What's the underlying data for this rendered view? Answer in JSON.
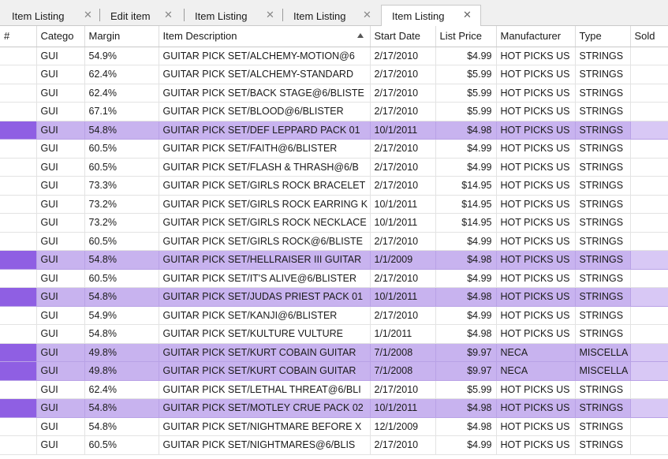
{
  "tabs": [
    {
      "label": "Item Listing",
      "active": false
    },
    {
      "label": "Edit item",
      "active": false
    },
    {
      "label": "Item Listing",
      "active": false
    },
    {
      "label": "Item Listing",
      "active": false
    },
    {
      "label": "Item Listing",
      "active": true
    }
  ],
  "close_glyph": "✕",
  "columns": [
    "#",
    "Catego",
    "Margin",
    "Item Description",
    "Start Date",
    "List Price",
    "Manufacturer",
    "Type",
    "Sold"
  ],
  "sorted_column": "Item Description",
  "rows": [
    {
      "cat": "GUI",
      "margin": "54.9%",
      "desc": "GUITAR PICK SET/ALCHEMY-MOTION@6",
      "date": "2/17/2010",
      "price": "$4.99",
      "mfr": "HOT PICKS US",
      "type": "STRINGS",
      "sold": "",
      "selected": false
    },
    {
      "cat": "GUI",
      "margin": "62.4%",
      "desc": "GUITAR PICK SET/ALCHEMY-STANDARD",
      "date": "2/17/2010",
      "price": "$5.99",
      "mfr": "HOT PICKS US",
      "type": "STRINGS",
      "sold": "",
      "selected": false
    },
    {
      "cat": "GUI",
      "margin": "62.4%",
      "desc": "GUITAR PICK SET/BACK STAGE@6/BLISTE",
      "date": "2/17/2010",
      "price": "$5.99",
      "mfr": "HOT PICKS US",
      "type": "STRINGS",
      "sold": "",
      "selected": false
    },
    {
      "cat": "GUI",
      "margin": "67.1%",
      "desc": "GUITAR PICK SET/BLOOD@6/BLISTER",
      "date": "2/17/2010",
      "price": "$5.99",
      "mfr": "HOT PICKS US",
      "type": "STRINGS",
      "sold": "",
      "selected": false
    },
    {
      "cat": "GUI",
      "margin": "54.8%",
      "desc": "GUITAR PICK SET/DEF LEPPARD PACK 01",
      "date": "10/1/2011",
      "price": "$4.98",
      "mfr": "HOT PICKS US",
      "type": "STRINGS",
      "sold": "",
      "selected": true
    },
    {
      "cat": "GUI",
      "margin": "60.5%",
      "desc": "GUITAR PICK SET/FAITH@6/BLISTER",
      "date": "2/17/2010",
      "price": "$4.99",
      "mfr": "HOT PICKS US",
      "type": "STRINGS",
      "sold": "",
      "selected": false
    },
    {
      "cat": "GUI",
      "margin": "60.5%",
      "desc": "GUITAR PICK SET/FLASH & THRASH@6/B",
      "date": "2/17/2010",
      "price": "$4.99",
      "mfr": "HOT PICKS US",
      "type": "STRINGS",
      "sold": "",
      "selected": false
    },
    {
      "cat": "GUI",
      "margin": "73.3%",
      "desc": "GUITAR PICK SET/GIRLS ROCK BRACELET",
      "date": "2/17/2010",
      "price": "$14.95",
      "mfr": "HOT PICKS US",
      "type": "STRINGS",
      "sold": "",
      "selected": false
    },
    {
      "cat": "GUI",
      "margin": "73.2%",
      "desc": "GUITAR PICK SET/GIRLS ROCK EARRING K",
      "date": "10/1/2011",
      "price": "$14.95",
      "mfr": "HOT PICKS US",
      "type": "STRINGS",
      "sold": "",
      "selected": false
    },
    {
      "cat": "GUI",
      "margin": "73.2%",
      "desc": "GUITAR PICK SET/GIRLS ROCK NECKLACE",
      "date": "10/1/2011",
      "price": "$14.95",
      "mfr": "HOT PICKS US",
      "type": "STRINGS",
      "sold": "",
      "selected": false
    },
    {
      "cat": "GUI",
      "margin": "60.5%",
      "desc": "GUITAR PICK SET/GIRLS ROCK@6/BLISTE",
      "date": "2/17/2010",
      "price": "$4.99",
      "mfr": "HOT PICKS US",
      "type": "STRINGS",
      "sold": "",
      "selected": false
    },
    {
      "cat": "GUI",
      "margin": "54.8%",
      "desc": "GUITAR PICK SET/HELLRAISER III GUITAR",
      "date": "1/1/2009",
      "price": "$4.98",
      "mfr": "HOT PICKS US",
      "type": "STRINGS",
      "sold": "",
      "selected": true
    },
    {
      "cat": "GUI",
      "margin": "60.5%",
      "desc": "GUITAR PICK SET/IT'S ALIVE@6/BLISTER",
      "date": "2/17/2010",
      "price": "$4.99",
      "mfr": "HOT PICKS US",
      "type": "STRINGS",
      "sold": "",
      "selected": false
    },
    {
      "cat": "GUI",
      "margin": "54.8%",
      "desc": "GUITAR PICK SET/JUDAS PRIEST PACK 01",
      "date": "10/1/2011",
      "price": "$4.98",
      "mfr": "HOT PICKS US",
      "type": "STRINGS",
      "sold": "",
      "selected": true
    },
    {
      "cat": "GUI",
      "margin": "54.9%",
      "desc": "GUITAR PICK SET/KANJI@6/BLISTER",
      "date": "2/17/2010",
      "price": "$4.99",
      "mfr": "HOT PICKS US",
      "type": "STRINGS",
      "sold": "",
      "selected": false
    },
    {
      "cat": "GUI",
      "margin": "54.8%",
      "desc": "GUITAR PICK SET/KULTURE VULTURE",
      "date": "1/1/2011",
      "price": "$4.98",
      "mfr": "HOT PICKS US",
      "type": "STRINGS",
      "sold": "",
      "selected": false
    },
    {
      "cat": "GUI",
      "margin": "49.8%",
      "desc": "GUITAR PICK SET/KURT COBAIN GUITAR",
      "date": "7/1/2008",
      "price": "$9.97",
      "mfr": "NECA",
      "type": "MISCELLA",
      "sold": "",
      "selected": true
    },
    {
      "cat": "GUI",
      "margin": "49.8%",
      "desc": "GUITAR PICK SET/KURT COBAIN GUITAR",
      "date": "7/1/2008",
      "price": "$9.97",
      "mfr": "NECA",
      "type": "MISCELLA",
      "sold": "",
      "selected": true
    },
    {
      "cat": "GUI",
      "margin": "62.4%",
      "desc": "GUITAR PICK SET/LETHAL THREAT@6/BLI",
      "date": "2/17/2010",
      "price": "$5.99",
      "mfr": "HOT PICKS US",
      "type": "STRINGS",
      "sold": "",
      "selected": false
    },
    {
      "cat": "GUI",
      "margin": "54.8%",
      "desc": "GUITAR PICK SET/MOTLEY CRUE PACK 02",
      "date": "10/1/2011",
      "price": "$4.98",
      "mfr": "HOT PICKS US",
      "type": "STRINGS",
      "sold": "",
      "selected": true
    },
    {
      "cat": "GUI",
      "margin": "54.8%",
      "desc": "GUITAR PICK SET/NIGHTMARE BEFORE X",
      "date": "12/1/2009",
      "price": "$4.98",
      "mfr": "HOT PICKS US",
      "type": "STRINGS",
      "sold": "",
      "selected": false
    },
    {
      "cat": "GUI",
      "margin": "60.5%",
      "desc": "GUITAR PICK SET/NIGHTMARES@6/BLIS",
      "date": "2/17/2010",
      "price": "$4.99",
      "mfr": "HOT PICKS US",
      "type": "STRINGS",
      "sold": "",
      "selected": false
    }
  ],
  "colors": {
    "selected_row": "#c8b3ef",
    "selected_row_marker": "#8f5fe3",
    "tab_bar": "#f0f0f0"
  }
}
